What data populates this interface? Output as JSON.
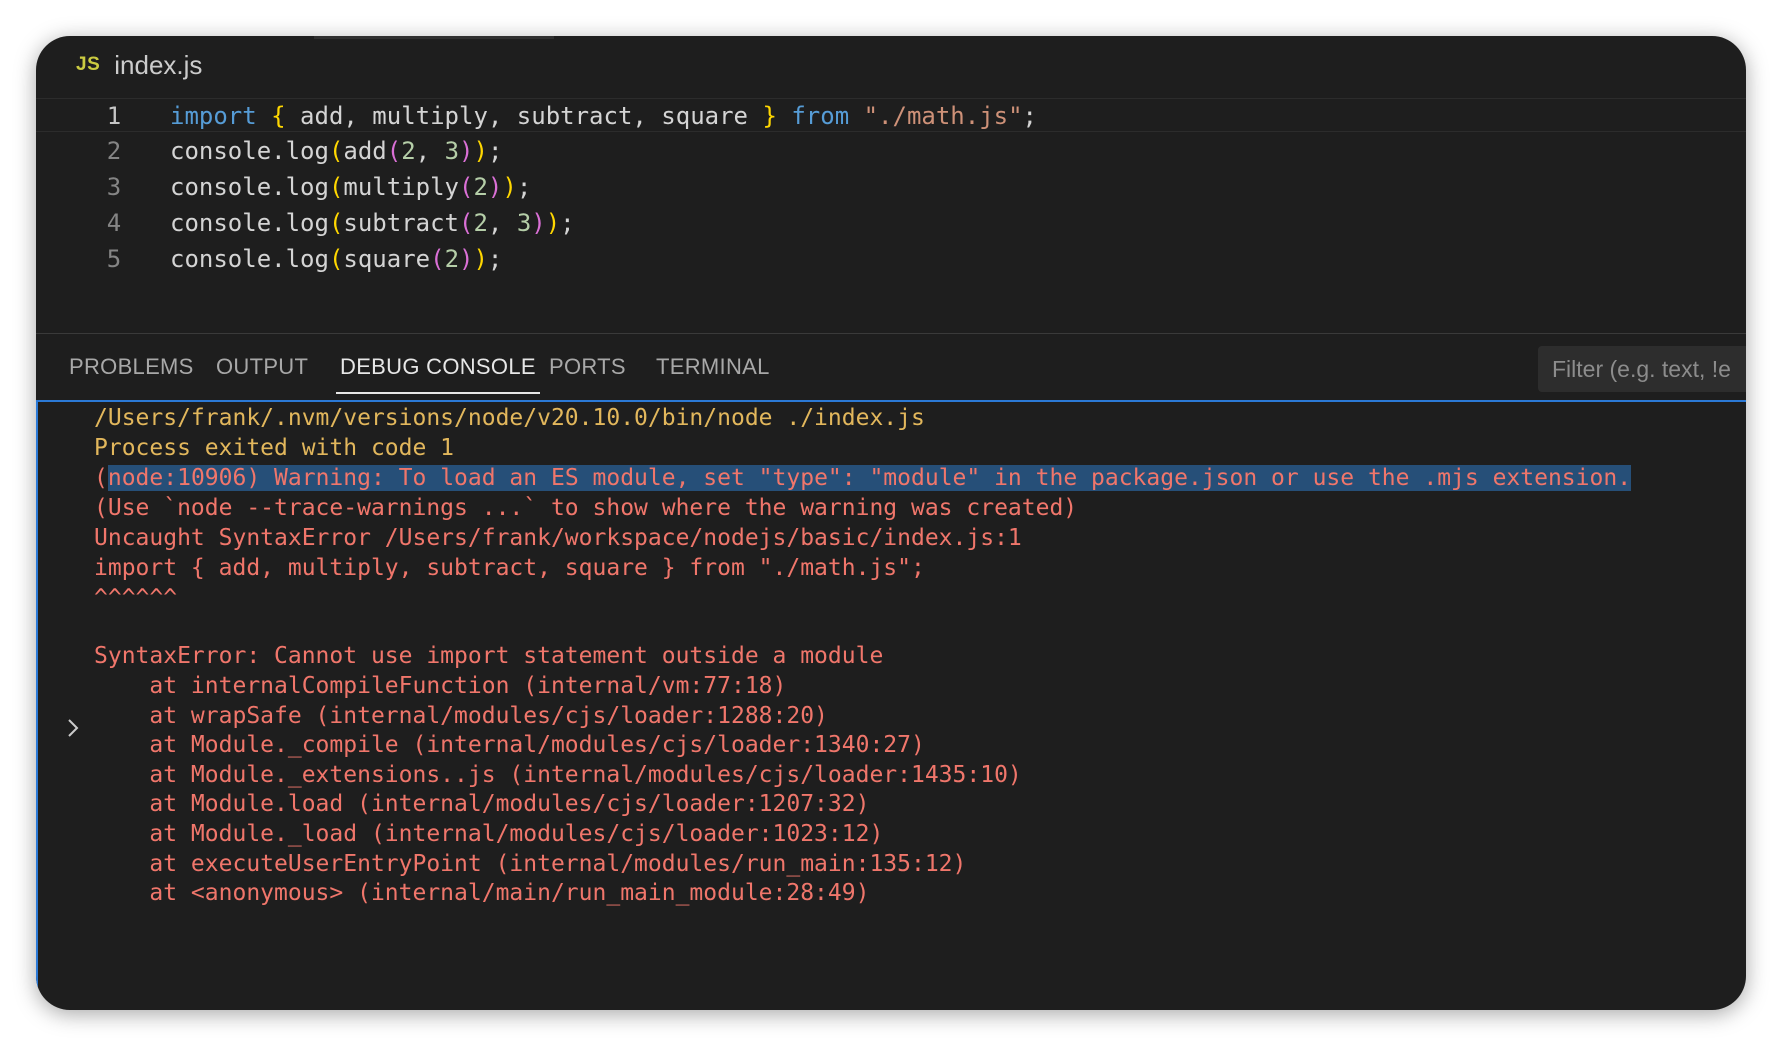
{
  "file_tab": {
    "icon": "JS",
    "name": "index.js"
  },
  "editor": {
    "lines": [
      {
        "num": "1",
        "parts": [
          {
            "t": "import",
            "c": "kw"
          },
          {
            "t": " "
          },
          {
            "t": "{",
            "c": "b1"
          },
          {
            "t": " add, multiply, subtract, square "
          },
          {
            "t": "}",
            "c": "b1"
          },
          {
            "t": " "
          },
          {
            "t": "from",
            "c": "kw"
          },
          {
            "t": " "
          },
          {
            "t": "\"./math.js\"",
            "c": "str"
          },
          {
            "t": ";"
          }
        ]
      },
      {
        "num": "2",
        "parts": [
          {
            "t": "console.log"
          },
          {
            "t": "(",
            "c": "b1"
          },
          {
            "t": "add"
          },
          {
            "t": "(",
            "c": "b2"
          },
          {
            "t": "2",
            "c": "num"
          },
          {
            "t": ", "
          },
          {
            "t": "3",
            "c": "num"
          },
          {
            "t": ")",
            "c": "b2"
          },
          {
            "t": ")",
            "c": "b1"
          },
          {
            "t": ";"
          }
        ]
      },
      {
        "num": "3",
        "parts": [
          {
            "t": "console.log"
          },
          {
            "t": "(",
            "c": "b1"
          },
          {
            "t": "multiply"
          },
          {
            "t": "(",
            "c": "b2"
          },
          {
            "t": "2",
            "c": "num"
          },
          {
            "t": ")",
            "c": "b2"
          },
          {
            "t": ")",
            "c": "b1"
          },
          {
            "t": ";"
          }
        ]
      },
      {
        "num": "4",
        "parts": [
          {
            "t": "console.log"
          },
          {
            "t": "(",
            "c": "b1"
          },
          {
            "t": "subtract"
          },
          {
            "t": "(",
            "c": "b2"
          },
          {
            "t": "2",
            "c": "num"
          },
          {
            "t": ", "
          },
          {
            "t": "3",
            "c": "num"
          },
          {
            "t": ")",
            "c": "b2"
          },
          {
            "t": ")",
            "c": "b1"
          },
          {
            "t": ";"
          }
        ]
      },
      {
        "num": "5",
        "parts": [
          {
            "t": "console.log"
          },
          {
            "t": "(",
            "c": "b1"
          },
          {
            "t": "square"
          },
          {
            "t": "(",
            "c": "b2"
          },
          {
            "t": "2",
            "c": "num"
          },
          {
            "t": ")",
            "c": "b2"
          },
          {
            "t": ")",
            "c": "b1"
          },
          {
            "t": ";"
          }
        ]
      }
    ]
  },
  "panel": {
    "tabs": [
      "PROBLEMS",
      "OUTPUT",
      "DEBUG CONSOLE",
      "PORTS",
      "TERMINAL"
    ],
    "active_tab": "DEBUG CONSOLE",
    "filter_placeholder": "Filter (e.g. text, !e"
  },
  "console": {
    "lines": [
      {
        "text": "/Users/frank/.nvm/versions/node/v20.10.0/bin/node ./index.js",
        "color": "yellow"
      },
      {
        "text": "Process exited with code 1",
        "color": "yellow"
      },
      {
        "text": "(node:10906) Warning: To load an ES module, set \"type\": \"module\" in the package.json or use the .mjs extension.",
        "color": "red",
        "highlight": true
      },
      {
        "text": "(Use `node --trace-warnings ...` to show where the warning was created)",
        "color": "red"
      },
      {
        "text": "Uncaught SyntaxError /Users/frank/workspace/nodejs/basic/index.js:1",
        "color": "red"
      },
      {
        "text": "import { add, multiply, subtract, square } from \"./math.js\";",
        "color": "red"
      },
      {
        "text": "^^^^^^",
        "color": "red"
      },
      {
        "text": "",
        "color": "red"
      },
      {
        "text": "SyntaxError: Cannot use import statement outside a module",
        "color": "red"
      },
      {
        "text": "    at internalCompileFunction (internal/vm:77:18)",
        "color": "red"
      },
      {
        "text": "    at wrapSafe (internal/modules/cjs/loader:1288:20)",
        "color": "red"
      },
      {
        "text": "    at Module._compile (internal/modules/cjs/loader:1340:27)",
        "color": "red"
      },
      {
        "text": "    at Module._extensions..js (internal/modules/cjs/loader:1435:10)",
        "color": "red"
      },
      {
        "text": "    at Module.load (internal/modules/cjs/loader:1207:32)",
        "color": "red"
      },
      {
        "text": "    at Module._load (internal/modules/cjs/loader:1023:12)",
        "color": "red"
      },
      {
        "text": "    at executeUserEntryPoint (internal/modules/run_main:135:12)",
        "color": "red"
      },
      {
        "text": "    at <anonymous> (internal/main/run_main_module:28:49)",
        "color": "red"
      }
    ]
  },
  "colors": {
    "background": "#1e1e1e",
    "console_yellow": "#e2b75c",
    "console_red": "#f0766b",
    "selection": "#264f78",
    "focus_border": "#2b79d6"
  }
}
